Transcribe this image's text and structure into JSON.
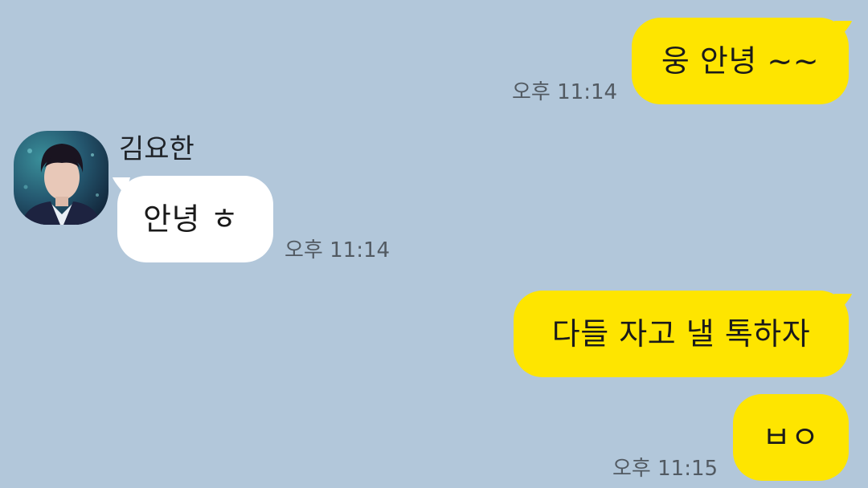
{
  "colors": {
    "background": "#b2c7da",
    "my_bubble": "#fee500",
    "their_bubble": "#ffffff",
    "timestamp": "#525a62"
  },
  "contact": {
    "name": "김요한",
    "avatar": "profile-photo"
  },
  "messages": [
    {
      "sender": "me",
      "text": "웅 안녕 ~~",
      "time": "오후 11:14"
    },
    {
      "sender": "contact",
      "text": "안녕 ㅎ",
      "time": "오후 11:14"
    },
    {
      "sender": "me",
      "text": "다들 자고 낼 톡하자",
      "time": ""
    },
    {
      "sender": "me",
      "text": "ㅂㅇ",
      "time": "오후 11:15"
    }
  ]
}
